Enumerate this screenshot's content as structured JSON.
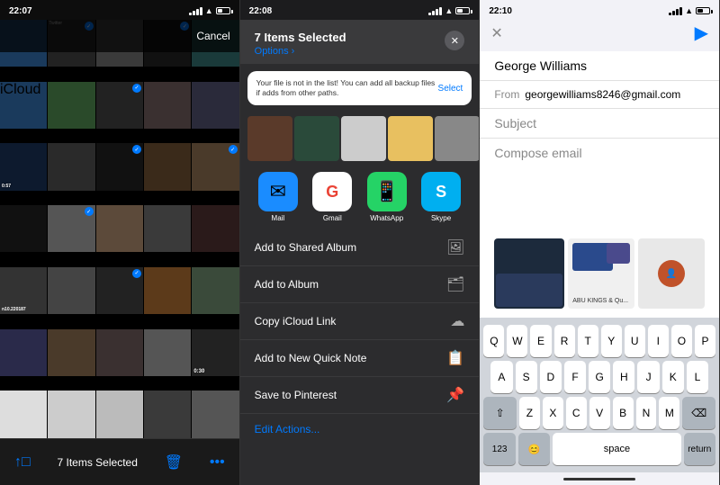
{
  "phone1": {
    "status": {
      "time": "22:07",
      "signal": 4,
      "wifi": true,
      "battery": 44
    },
    "nav": {
      "cancel_label": "Cancel"
    },
    "bottom_bar": {
      "selected_label": "7 Items Selected"
    },
    "photos": [
      {
        "color": "pc-blue"
      },
      {
        "color": "pc-dark"
      },
      {
        "color": "pc-gray check"
      },
      {
        "color": "pc-dark"
      },
      {
        "color": "pc-dark"
      },
      {
        "color": "pc-dark"
      },
      {
        "color": "pc-dark"
      },
      {
        "color": "pc-dark check"
      },
      {
        "color": "pc-dark"
      },
      {
        "color": "pc-dark"
      },
      {
        "color": "pc-teal"
      },
      {
        "color": "pc-dark check"
      },
      {
        "color": "pc-dark"
      },
      {
        "color": "pc-dark"
      },
      {
        "color": "pc-gray"
      },
      {
        "color": "pc-dark"
      },
      {
        "color": "pc-dark"
      },
      {
        "color": "pc-orange"
      },
      {
        "color": "pc-dark check"
      },
      {
        "color": "pc-tan"
      },
      {
        "color": "pc-dark"
      },
      {
        "color": "pc-white"
      },
      {
        "color": "pc-light"
      },
      {
        "color": "pc-dark"
      },
      {
        "color": "pc-dark"
      },
      {
        "color": "pc-tan"
      },
      {
        "color": "pc-orange check"
      },
      {
        "color": "pc-dark"
      },
      {
        "color": "pc-light"
      },
      {
        "color": "pc-dark"
      },
      {
        "color": "pc-dark"
      },
      {
        "color": "pc-dark"
      },
      {
        "color": "pc-dark check"
      },
      {
        "color": "pc-dark"
      },
      {
        "color": "pc-gray"
      },
      {
        "color": "pc-teal"
      },
      {
        "color": "pc-dark"
      },
      {
        "color": "pc-dark"
      },
      {
        "color": "pc-white check"
      },
      {
        "color": "pc-tan"
      },
      {
        "color": "pc-dark"
      },
      {
        "color": "pc-dark"
      },
      {
        "color": "pc-dark"
      },
      {
        "color": "pc-dark"
      },
      {
        "color": "pc-dark"
      }
    ]
  },
  "phone2": {
    "status": {
      "time": "22:08",
      "signal": 4,
      "wifi": true,
      "battery": 48
    },
    "share_sheet": {
      "title": "7 Items Selected",
      "options_label": "Options ›",
      "info_text": "Your file is not in the list! You can add all backup files if adds from other paths.",
      "select_label": "Select",
      "apps": [
        {
          "name": "Mail",
          "icon": "✉️"
        },
        {
          "name": "Gmail",
          "icon": "G"
        },
        {
          "name": "WhatsApp",
          "icon": "📱"
        },
        {
          "name": "Skype",
          "icon": "S"
        }
      ],
      "actions": [
        {
          "label": "Add to Shared Album",
          "icon": "🖼"
        },
        {
          "label": "Add to Album",
          "icon": "🗂"
        },
        {
          "label": "Copy iCloud Link",
          "icon": "☁"
        },
        {
          "label": "Add to New Quick Note",
          "icon": "📋"
        },
        {
          "label": "Save to Pinterest",
          "icon": "📌"
        }
      ],
      "edit_actions_label": "Edit Actions..."
    }
  },
  "phone3": {
    "status": {
      "time": "22:10",
      "signal": 4,
      "wifi": true,
      "battery": 48
    },
    "email": {
      "to": "George Williams",
      "from_label": "From",
      "from_value": "georgewilliams8246@gmail.com",
      "subject_placeholder": "Subject",
      "body_placeholder": "Compose email"
    },
    "keyboard": {
      "rows": [
        [
          "Q",
          "W",
          "E",
          "R",
          "T",
          "Y",
          "U",
          "I",
          "O",
          "P"
        ],
        [
          "A",
          "S",
          "D",
          "F",
          "G",
          "H",
          "J",
          "K",
          "L"
        ],
        [
          "⇧",
          "Z",
          "X",
          "C",
          "V",
          "B",
          "N",
          "M",
          "⌫"
        ],
        [
          "123",
          "😊",
          "space",
          "return"
        ]
      ]
    }
  }
}
